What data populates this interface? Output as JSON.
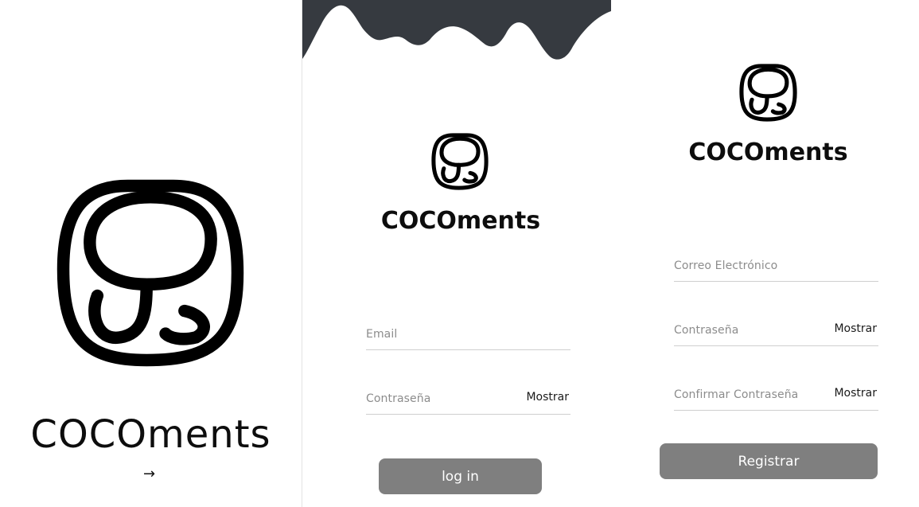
{
  "brand": {
    "name": "COCOments"
  },
  "splash": {
    "next_arrow": "→"
  },
  "login": {
    "email_placeholder": "Email",
    "password_placeholder": "Contraseña",
    "show_label": "Mostrar",
    "submit_label": "log in"
  },
  "register": {
    "email_placeholder": "Correo Electrónico",
    "password_placeholder": "Contraseña",
    "confirm_placeholder": "Confirmar Contraseña",
    "show_label": "Mostrar",
    "submit_label": "Registrar"
  },
  "colors": {
    "button_bg": "#7f7f7f",
    "wave": "#363a40",
    "field_line": "#cfcfcf",
    "placeholder": "#8c8c8c"
  },
  "icons": [
    "cocoments-logo-icon",
    "arrow-right-icon"
  ]
}
